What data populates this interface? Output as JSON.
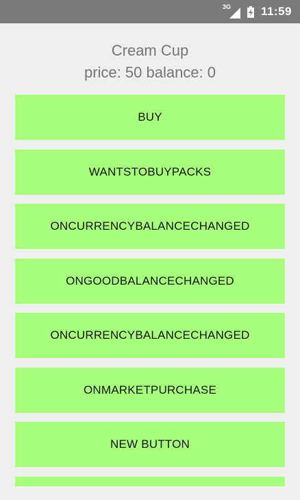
{
  "status_bar": {
    "network": "3G",
    "time": "11:59",
    "icons": [
      "signal-icon",
      "battery-charging-icon"
    ]
  },
  "header": {
    "item_name": "Cream Cup",
    "item_info": "price: 50 balance: 0"
  },
  "buttons": [
    "BUY",
    "WANTSTOBUYPACKS",
    "ONCURRENCYBALANCECHANGED",
    "ONGOODBALANCECHANGED",
    "ONCURRENCYBALANCECHANGED",
    "ONMARKETPURCHASE",
    "NEW BUTTON",
    ""
  ],
  "colors": {
    "status_bar": "#7a7a7a",
    "background": "#efefef",
    "button": "#a8ff7c",
    "header_text": "#757575"
  }
}
